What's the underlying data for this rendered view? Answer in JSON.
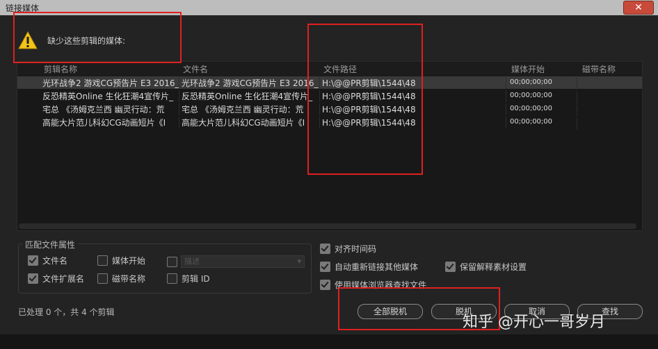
{
  "window": {
    "title": "链接媒体",
    "close_glyph": "✕"
  },
  "warning": {
    "icon": "warning-triangle-icon",
    "text": "缺少这些剪辑的媒体:"
  },
  "table": {
    "columns": [
      "剪辑名称",
      "文件名",
      "文件路径",
      "媒体开始",
      "磁带名称"
    ],
    "rows": [
      {
        "clip": "光环战争2 游戏CG预告片 E3 2016_",
        "file": "光环战争2 游戏CG预告片 E3 2016_",
        "path": "H:\\@@PR剪辑\\1544\\48",
        "start": "00;00;00;00",
        "tape": ""
      },
      {
        "clip": "反恐精英Online 生化狂潮4宣传片_",
        "file": "反恐精英Online 生化狂潮4宣传片_",
        "path": "H:\\@@PR剪辑\\1544\\48",
        "start": "00;00;00;00",
        "tape": ""
      },
      {
        "clip": "宅总 《汤姆克兰西 幽灵行动：荒",
        "file": "宅总 《汤姆克兰西 幽灵行动：荒",
        "path": "H:\\@@PR剪辑\\1544\\48",
        "start": "00;00;00;00",
        "tape": ""
      },
      {
        "clip": "高能大片范儿科幻CG动画短片《I",
        "file": "高能大片范儿科幻CG动画短片《I",
        "path": "H:\\@@PR剪辑\\1544\\48",
        "start": "00;00;00;00",
        "tape": ""
      }
    ]
  },
  "match": {
    "label": "匹配文件属性",
    "filename": "文件名",
    "media_start": "媒体开始",
    "description_select": "描述",
    "extension": "文件扩展名",
    "tape_name": "磁带名称",
    "clip_id": "剪辑 ID"
  },
  "options": {
    "align_timecode": "对齐时间码",
    "auto_relink": "自动重新链接其他媒体",
    "preserve_interpret": "保留解释素材设置",
    "use_browser": "使用媒体浏览器查找文件"
  },
  "status": "已处理 0 个，共 4 个剪辑",
  "buttons": {
    "offline_all": "全部脱机",
    "offline": "脱机",
    "cancel": "取消",
    "find": "查找"
  },
  "watermark": "知乎 @开心一哥岁月",
  "colors": {
    "annotation_red": "#e02020"
  }
}
